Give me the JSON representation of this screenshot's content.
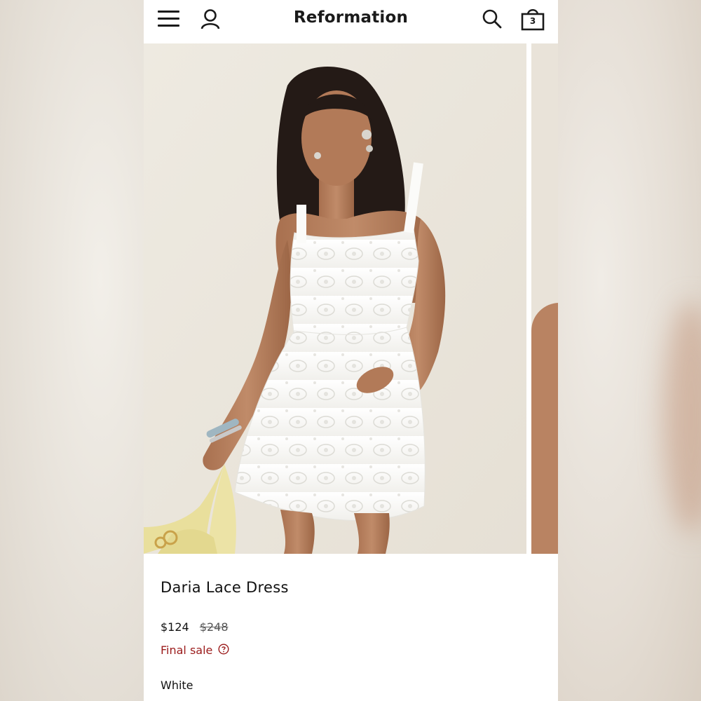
{
  "header": {
    "brand": "Reformation",
    "bag_count": "3",
    "icons": [
      "menu-icon",
      "account-icon",
      "search-icon",
      "shopping-bag-icon"
    ]
  },
  "gallery": {
    "current_image": "model-in-white-lace-mini-dress"
  },
  "product": {
    "title": "Daria Lace Dress",
    "price_sale": "$124",
    "price_original": "$248",
    "final_sale_label": "Final sale",
    "color": "White"
  },
  "colors": {
    "final_sale": "#9b1b1b",
    "text": "#111111",
    "background": "#ffffff"
  }
}
